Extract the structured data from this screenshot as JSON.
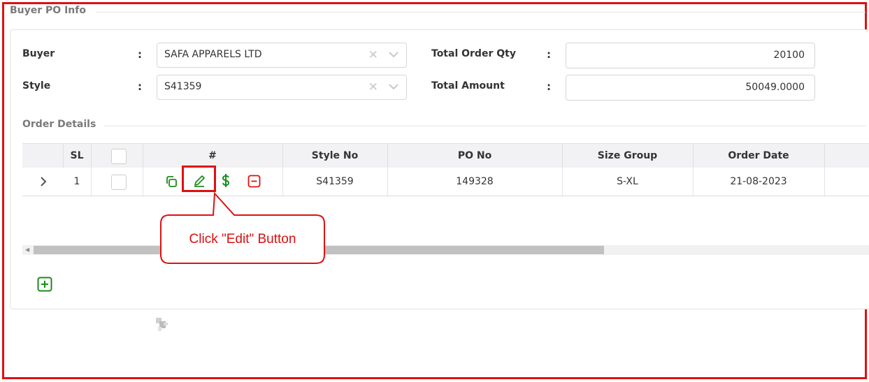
{
  "section": {
    "title": "Buyer PO Info"
  },
  "form": {
    "buyer_label": "Buyer",
    "buyer_value": "SAFA APPARELS LTD",
    "style_label": "Style",
    "style_value": "S41359",
    "colon": ":",
    "total_qty_label": "Total Order Qty",
    "total_qty_value": "20100",
    "total_amount_label": "Total Amount",
    "total_amount_value": "50049.0000"
  },
  "order_details": {
    "title": "Order Details",
    "columns": [
      "SL",
      "#",
      "Style No",
      "PO No",
      "Size Group",
      "Order Date"
    ],
    "rows": [
      {
        "sl": "1",
        "style_no": "S41359",
        "po_no": "149328",
        "size_group": "S-XL",
        "order_date": "21-08-2023"
      }
    ]
  },
  "annotation": {
    "callout": "Click \"Edit\" Button"
  },
  "icons": {
    "copy": "copy-icon",
    "edit": "pencil-icon",
    "price": "dollar-icon",
    "remove": "minus-square-icon",
    "add": "plus-square-icon",
    "expand": "chevron-right-icon",
    "clear": "close-icon",
    "dropdown": "chevron-down-icon"
  },
  "colors": {
    "accent_green": "#1a8c1a",
    "danger_red": "#e01010",
    "annotation_red": "#d81010"
  }
}
